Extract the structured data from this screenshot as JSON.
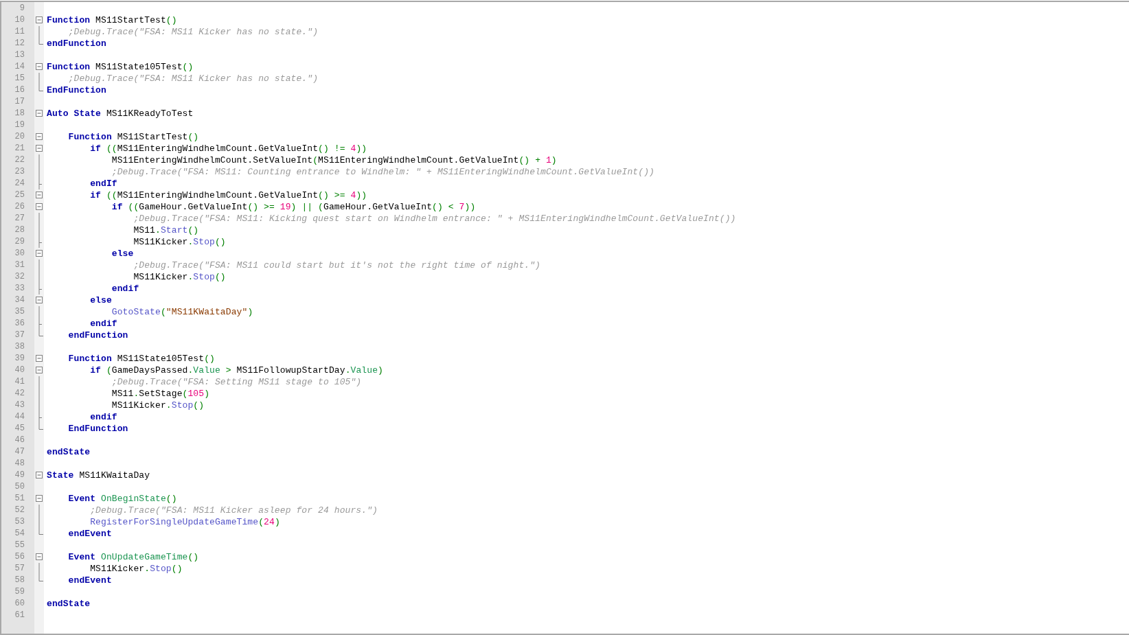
{
  "editor": {
    "lines": [
      {
        "number": "9"
      },
      {
        "number": "10",
        "kind": "box",
        "tokens": [
          {
            "kind": "kw",
            "text": "Function"
          },
          {
            "kind": "id",
            "text": " MS11StartTest"
          },
          {
            "kind": "p",
            "text": "()"
          }
        ]
      },
      {
        "number": "11",
        "kind": "line",
        "tokens": [
          {
            "kind": "cm",
            "text": "    ;Debug.Trace(\"FSA: MS11 Kicker has no state.\")"
          }
        ]
      },
      {
        "number": "12",
        "kind": "end",
        "tokens": [
          {
            "kind": "kw",
            "text": "endFunction"
          }
        ]
      },
      {
        "number": "13"
      },
      {
        "number": "14",
        "kind": "box",
        "tokens": [
          {
            "kind": "kw",
            "text": "Function"
          },
          {
            "kind": "id",
            "text": " MS11State105Test"
          },
          {
            "kind": "p",
            "text": "()"
          }
        ]
      },
      {
        "number": "15",
        "kind": "line",
        "tokens": [
          {
            "kind": "cm",
            "text": "    ;Debug.Trace(\"FSA: MS11 Kicker has no state.\")"
          }
        ]
      },
      {
        "number": "16",
        "kind": "end",
        "tokens": [
          {
            "kind": "kw",
            "text": "EndFunction"
          }
        ]
      },
      {
        "number": "17"
      },
      {
        "number": "18",
        "kind": "box",
        "tokens": [
          {
            "kind": "kw",
            "text": "Auto State"
          },
          {
            "kind": "id",
            "text": " MS11KReadyToTest"
          }
        ]
      },
      {
        "number": "19"
      },
      {
        "number": "20",
        "kind": "box",
        "tokens": [
          {
            "kind": "kw",
            "text": "    Function"
          },
          {
            "kind": "id",
            "text": " MS11StartTest"
          },
          {
            "kind": "p",
            "text": "()"
          }
        ]
      },
      {
        "number": "21",
        "kind": "box",
        "tokens": [
          {
            "kind": "kw",
            "text": "        if"
          },
          {
            "kind": "p",
            "text": " (("
          },
          {
            "kind": "id",
            "text": "MS11EnteringWindhelmCount.GetValueInt"
          },
          {
            "kind": "p",
            "text": "() != "
          },
          {
            "kind": "num",
            "text": "4"
          },
          {
            "kind": "p",
            "text": "))"
          }
        ]
      },
      {
        "number": "22",
        "kind": "line",
        "tokens": [
          {
            "kind": "id",
            "text": "            MS11EnteringWindhelmCount.SetValueInt"
          },
          {
            "kind": "p",
            "text": "("
          },
          {
            "kind": "id",
            "text": "MS11EnteringWindhelmCount.GetValueInt"
          },
          {
            "kind": "p",
            "text": "() + "
          },
          {
            "kind": "num",
            "text": "1"
          },
          {
            "kind": "p",
            "text": ")"
          }
        ]
      },
      {
        "number": "23",
        "kind": "line",
        "tokens": [
          {
            "kind": "cm",
            "text": "            ;Debug.Trace(\"FSA: MS11: Counting entrance to Windhelm: \" + MS11EnteringWindhelmCount.GetValueInt())"
          }
        ]
      },
      {
        "number": "24",
        "kind": "mid",
        "tokens": [
          {
            "kind": "kw",
            "text": "        endIf"
          }
        ]
      },
      {
        "number": "25",
        "kind": "box",
        "tokens": [
          {
            "kind": "kw",
            "text": "        if"
          },
          {
            "kind": "p",
            "text": " (("
          },
          {
            "kind": "id",
            "text": "MS11EnteringWindhelmCount.GetValueInt"
          },
          {
            "kind": "p",
            "text": "() >= "
          },
          {
            "kind": "num",
            "text": "4"
          },
          {
            "kind": "p",
            "text": "))"
          }
        ]
      },
      {
        "number": "26",
        "kind": "box",
        "tokens": [
          {
            "kind": "kw",
            "text": "            if"
          },
          {
            "kind": "p",
            "text": " (("
          },
          {
            "kind": "id",
            "text": "GameHour.GetValueInt"
          },
          {
            "kind": "p",
            "text": "() >= "
          },
          {
            "kind": "num",
            "text": "19"
          },
          {
            "kind": "p",
            "text": ") || ("
          },
          {
            "kind": "id",
            "text": "GameHour.GetValueInt"
          },
          {
            "kind": "p",
            "text": "() < "
          },
          {
            "kind": "num",
            "text": "7"
          },
          {
            "kind": "p",
            "text": "))"
          }
        ]
      },
      {
        "number": "27",
        "kind": "line",
        "tokens": [
          {
            "kind": "cm",
            "text": "                ;Debug.Trace(\"FSA: MS11: Kicking quest start on Windhelm entrance: \" + MS11EnteringWindhelmCount.GetValueInt())"
          }
        ]
      },
      {
        "number": "28",
        "kind": "line",
        "tokens": [
          {
            "kind": "id",
            "text": "                MS11"
          },
          {
            "kind": "p",
            "text": "."
          },
          {
            "kind": "fn",
            "text": "Start"
          },
          {
            "kind": "p",
            "text": "()"
          }
        ]
      },
      {
        "number": "29",
        "kind": "mid",
        "tokens": [
          {
            "kind": "id",
            "text": "                MS11Kicker"
          },
          {
            "kind": "p",
            "text": "."
          },
          {
            "kind": "fn",
            "text": "Stop"
          },
          {
            "kind": "p",
            "text": "()"
          }
        ]
      },
      {
        "number": "30",
        "kind": "box",
        "tokens": [
          {
            "kind": "kw",
            "text": "            else"
          }
        ]
      },
      {
        "number": "31",
        "kind": "line",
        "tokens": [
          {
            "kind": "cm",
            "text": "                ;Debug.Trace(\"FSA: MS11 could start but it's not the right time of night.\")"
          }
        ]
      },
      {
        "number": "32",
        "kind": "line",
        "tokens": [
          {
            "kind": "id",
            "text": "                MS11Kicker"
          },
          {
            "kind": "p",
            "text": "."
          },
          {
            "kind": "fn",
            "text": "Stop"
          },
          {
            "kind": "p",
            "text": "()"
          }
        ]
      },
      {
        "number": "33",
        "kind": "mid",
        "tokens": [
          {
            "kind": "kw",
            "text": "            endif"
          }
        ]
      },
      {
        "number": "34",
        "kind": "box",
        "tokens": [
          {
            "kind": "kw",
            "text": "        else"
          }
        ]
      },
      {
        "number": "35",
        "kind": "line",
        "tokens": [
          {
            "kind": "fn",
            "text": "            GotoState"
          },
          {
            "kind": "p",
            "text": "("
          },
          {
            "kind": "str",
            "text": "\"MS11KWaitaDay\""
          },
          {
            "kind": "p",
            "text": ")"
          }
        ]
      },
      {
        "number": "36",
        "kind": "mid",
        "tokens": [
          {
            "kind": "kw",
            "text": "        endif"
          }
        ]
      },
      {
        "number": "37",
        "kind": "end",
        "tokens": [
          {
            "kind": "kw",
            "text": "    endFunction"
          }
        ]
      },
      {
        "number": "38"
      },
      {
        "number": "39",
        "kind": "box",
        "tokens": [
          {
            "kind": "kw",
            "text": "    Function"
          },
          {
            "kind": "id",
            "text": " MS11State105Test"
          },
          {
            "kind": "p",
            "text": "()"
          }
        ]
      },
      {
        "number": "40",
        "kind": "box",
        "tokens": [
          {
            "kind": "kw",
            "text": "        if"
          },
          {
            "kind": "p",
            "text": " ("
          },
          {
            "kind": "id",
            "text": "GameDaysPassed"
          },
          {
            "kind": "p",
            "text": "."
          },
          {
            "kind": "prop",
            "text": "Value"
          },
          {
            "kind": "p",
            "text": " > "
          },
          {
            "kind": "id",
            "text": "MS11FollowupStartDay"
          },
          {
            "kind": "p",
            "text": "."
          },
          {
            "kind": "prop",
            "text": "Value"
          },
          {
            "kind": "p",
            "text": ")"
          }
        ]
      },
      {
        "number": "41",
        "kind": "line",
        "tokens": [
          {
            "kind": "cm",
            "text": "            ;Debug.Trace(\"FSA: Setting MS11 stage to 105\")"
          }
        ]
      },
      {
        "number": "42",
        "kind": "line",
        "tokens": [
          {
            "kind": "id",
            "text": "            MS11"
          },
          {
            "kind": "p",
            "text": "."
          },
          {
            "kind": "id",
            "text": "SetStage"
          },
          {
            "kind": "p",
            "text": "("
          },
          {
            "kind": "num",
            "text": "105"
          },
          {
            "kind": "p",
            "text": ")"
          }
        ]
      },
      {
        "number": "43",
        "kind": "line",
        "tokens": [
          {
            "kind": "id",
            "text": "            MS11Kicker"
          },
          {
            "kind": "p",
            "text": "."
          },
          {
            "kind": "fn",
            "text": "Stop"
          },
          {
            "kind": "p",
            "text": "()"
          }
        ]
      },
      {
        "number": "44",
        "kind": "mid",
        "tokens": [
          {
            "kind": "kw",
            "text": "        endif"
          }
        ]
      },
      {
        "number": "45",
        "kind": "end",
        "tokens": [
          {
            "kind": "kw",
            "text": "    EndFunction"
          }
        ]
      },
      {
        "number": "46"
      },
      {
        "number": "47",
        "tokens": [
          {
            "kind": "kw",
            "text": "endState"
          }
        ]
      },
      {
        "number": "48"
      },
      {
        "number": "49",
        "kind": "box",
        "tokens": [
          {
            "kind": "kw",
            "text": "State"
          },
          {
            "kind": "id",
            "text": " MS11KWaitaDay"
          }
        ]
      },
      {
        "number": "50"
      },
      {
        "number": "51",
        "kind": "box",
        "tokens": [
          {
            "kind": "kw",
            "text": "    Event"
          },
          {
            "kind": "prop",
            "text": " OnBeginState"
          },
          {
            "kind": "p",
            "text": "()"
          }
        ]
      },
      {
        "number": "52",
        "kind": "line",
        "tokens": [
          {
            "kind": "cm",
            "text": "        ;Debug.Trace(\"FSA: MS11 Kicker asleep for 24 hours.\")"
          }
        ]
      },
      {
        "number": "53",
        "kind": "line",
        "tokens": [
          {
            "kind": "fn",
            "text": "        RegisterForSingleUpdateGameTime"
          },
          {
            "kind": "p",
            "text": "("
          },
          {
            "kind": "num",
            "text": "24"
          },
          {
            "kind": "p",
            "text": ")"
          }
        ]
      },
      {
        "number": "54",
        "kind": "end",
        "tokens": [
          {
            "kind": "kw",
            "text": "    endEvent"
          }
        ]
      },
      {
        "number": "55"
      },
      {
        "number": "56",
        "kind": "box",
        "tokens": [
          {
            "kind": "kw",
            "text": "    Event"
          },
          {
            "kind": "prop",
            "text": " OnUpdateGameTime"
          },
          {
            "kind": "p",
            "text": "()"
          }
        ]
      },
      {
        "number": "57",
        "kind": "line",
        "tokens": [
          {
            "kind": "id",
            "text": "        MS11Kicker"
          },
          {
            "kind": "p",
            "text": "."
          },
          {
            "kind": "fn",
            "text": "Stop"
          },
          {
            "kind": "p",
            "text": "()"
          }
        ]
      },
      {
        "number": "58",
        "kind": "end",
        "tokens": [
          {
            "kind": "kw",
            "text": "    endEvent"
          }
        ]
      },
      {
        "number": "59"
      },
      {
        "number": "60",
        "tokens": [
          {
            "kind": "kw",
            "text": "endState"
          }
        ]
      },
      {
        "number": "61"
      }
    ]
  }
}
